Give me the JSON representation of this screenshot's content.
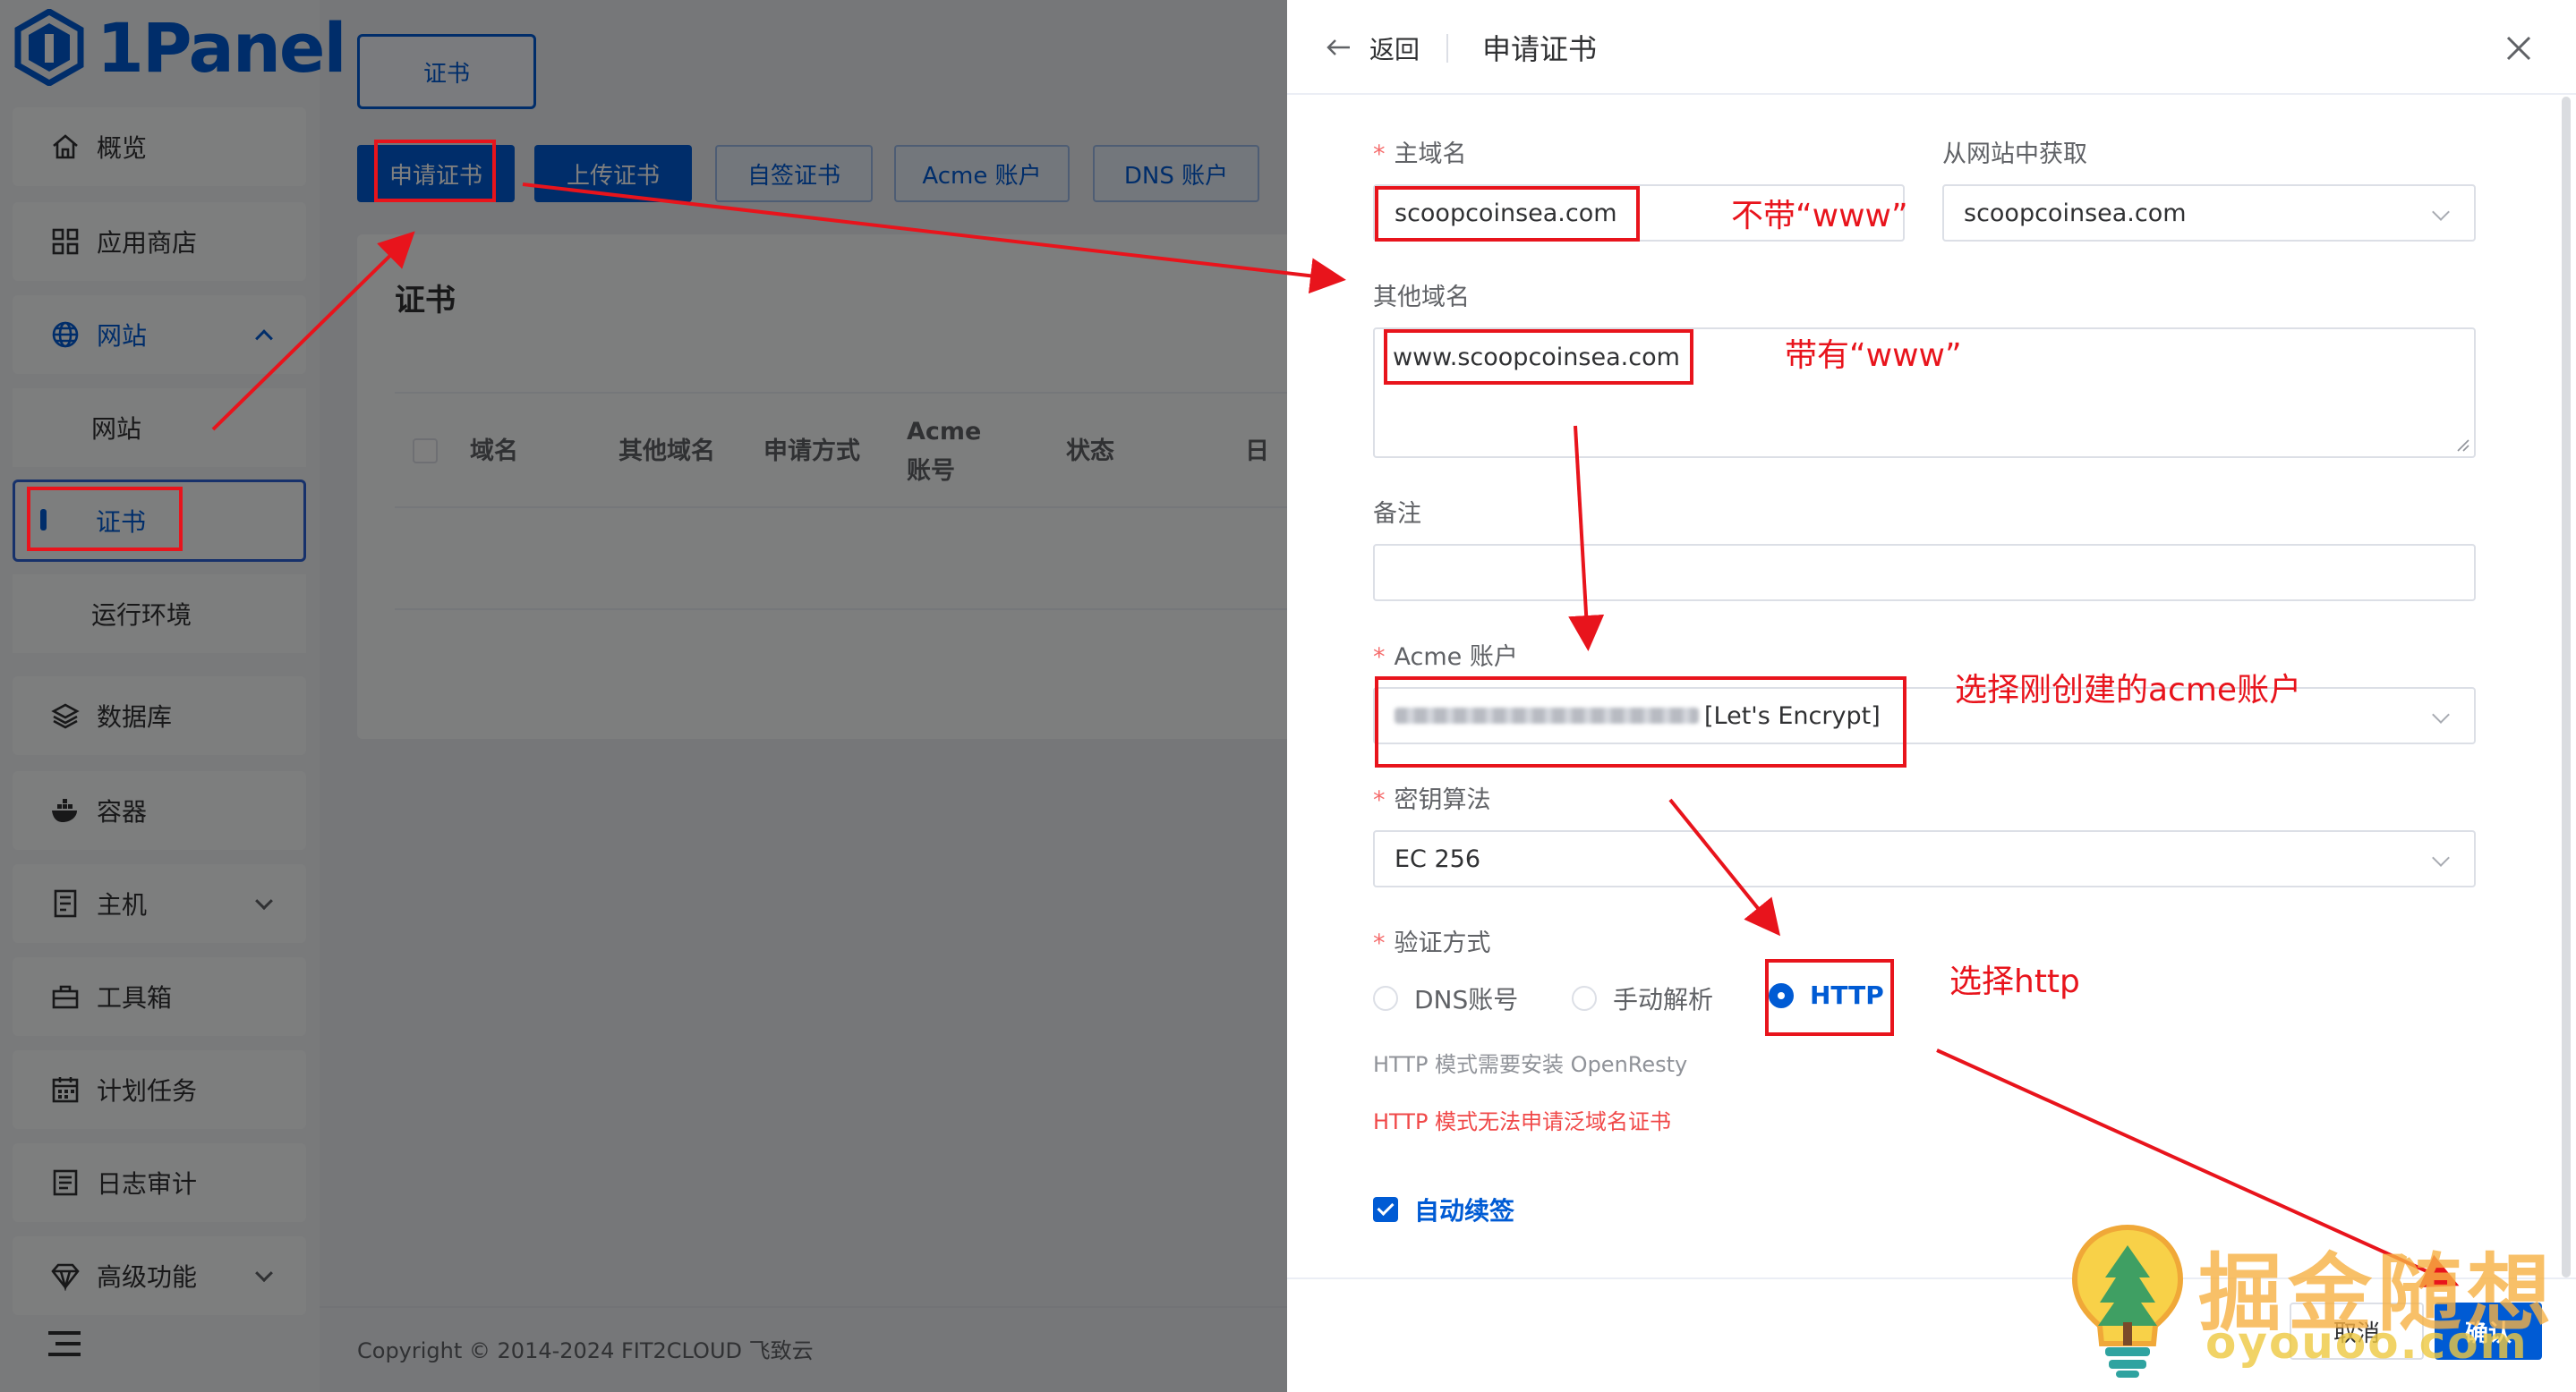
{
  "app": {
    "logo_text": "1Panel"
  },
  "sidebar": {
    "items": [
      {
        "label": "概览",
        "icon": "home-icon"
      },
      {
        "label": "应用商店",
        "icon": "grid-icon"
      },
      {
        "label": "网站",
        "icon": "globe-icon"
      },
      {
        "label": "网站"
      },
      {
        "label": "证书"
      },
      {
        "label": "运行环境"
      },
      {
        "label": "数据库",
        "icon": "layers-icon"
      },
      {
        "label": "容器",
        "icon": "docker-icon"
      },
      {
        "label": "主机",
        "icon": "host-icon"
      },
      {
        "label": "工具箱",
        "icon": "toolbox-icon"
      },
      {
        "label": "计划任务",
        "icon": "calendar-icon"
      },
      {
        "label": "日志审计",
        "icon": "log-icon"
      },
      {
        "label": "高级功能",
        "icon": "diamond-icon"
      }
    ]
  },
  "main": {
    "tab_label": "证书",
    "toolbar": [
      "申请证书",
      "上传证书",
      "自签证书",
      "Acme 账户",
      "DNS 账户"
    ],
    "card_title": "证书",
    "columns": [
      "域名",
      "其他域名",
      "申请方式",
      "Acme\n账号",
      "状态",
      "日"
    ],
    "footer": "Copyright © 2014-2024 FIT2CLOUD 飞致云"
  },
  "drawer": {
    "back_label": "返回",
    "title": "申请证书",
    "form": {
      "primary_domain_label": "主域名",
      "primary_domain_value": "scoopcoinsea.com",
      "from_site_label": "从网站中获取",
      "from_site_value": "scoopcoinsea.com",
      "other_domains_label": "其他域名",
      "other_domains_value": "www.scoopcoinsea.com",
      "remark_label": "备注",
      "acme_label": "Acme 账户",
      "acme_value_suffix": "[Let's Encrypt]",
      "key_algo_label": "密钥算法",
      "key_algo_value": "EC 256",
      "verify_label": "验证方式",
      "verify_options": [
        "DNS账号",
        "手动解析",
        "HTTP"
      ],
      "verify_selected": "HTTP",
      "hint_http": "HTTP 模式需要安装 OpenResty",
      "hint_warn": "HTTP 模式无法申请泛域名证书",
      "auto_renew_label": "自动续签",
      "auto_renew_checked": true
    },
    "cancel_label": "取消",
    "confirm_label": "确认"
  },
  "annotations": {
    "no_www": "不带“www”",
    "with_www": "带有“www”",
    "select_acme": "选择刚创建的acme账户",
    "select_http": "选择http"
  },
  "watermark": {
    "title": "掘金随想",
    "url": "oyouoo.com"
  },
  "colors": {
    "primary": "#005bd4",
    "annotation": "#e8141c",
    "danger": "#f56c6c"
  }
}
